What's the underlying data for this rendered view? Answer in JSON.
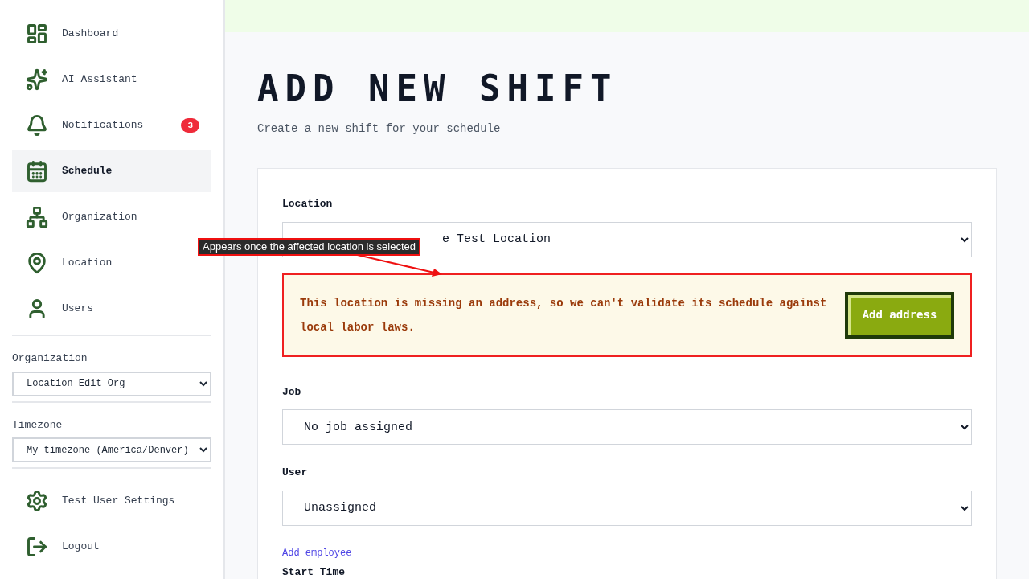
{
  "sidebar": {
    "items": [
      {
        "label": "Dashboard",
        "selected": false
      },
      {
        "label": "AI Assistant",
        "selected": false
      },
      {
        "label": "Notifications",
        "selected": false,
        "badge": "3"
      },
      {
        "label": "Schedule",
        "selected": true
      },
      {
        "label": "Organization",
        "selected": false
      },
      {
        "label": "Location",
        "selected": false
      },
      {
        "label": "Users",
        "selected": false
      }
    ],
    "selectors": [
      {
        "label": "Organization",
        "value": "Location Edit Org"
      },
      {
        "label": "Timezone",
        "value": "My timezone (America/Denver)"
      }
    ],
    "footer_items": [
      {
        "label": "Test User Settings"
      },
      {
        "label": "Logout"
      }
    ]
  },
  "page": {
    "title": "ADD NEW SHIFT",
    "subtitle": "Create a new shift for your schedule"
  },
  "form": {
    "location": {
      "label": "Location",
      "value": "e Test Location"
    },
    "warning": {
      "message": "This location is missing an address, so we can't validate its schedule against local labor laws.",
      "button": "Add address"
    },
    "job": {
      "label": "Job",
      "value": "No job assigned"
    },
    "user": {
      "label": "User",
      "value": "Unassigned"
    },
    "add_employee": "Add employee",
    "start_time": {
      "label": "Start Time"
    }
  },
  "annotation": {
    "text": "Appears once the affected location is selected"
  }
}
